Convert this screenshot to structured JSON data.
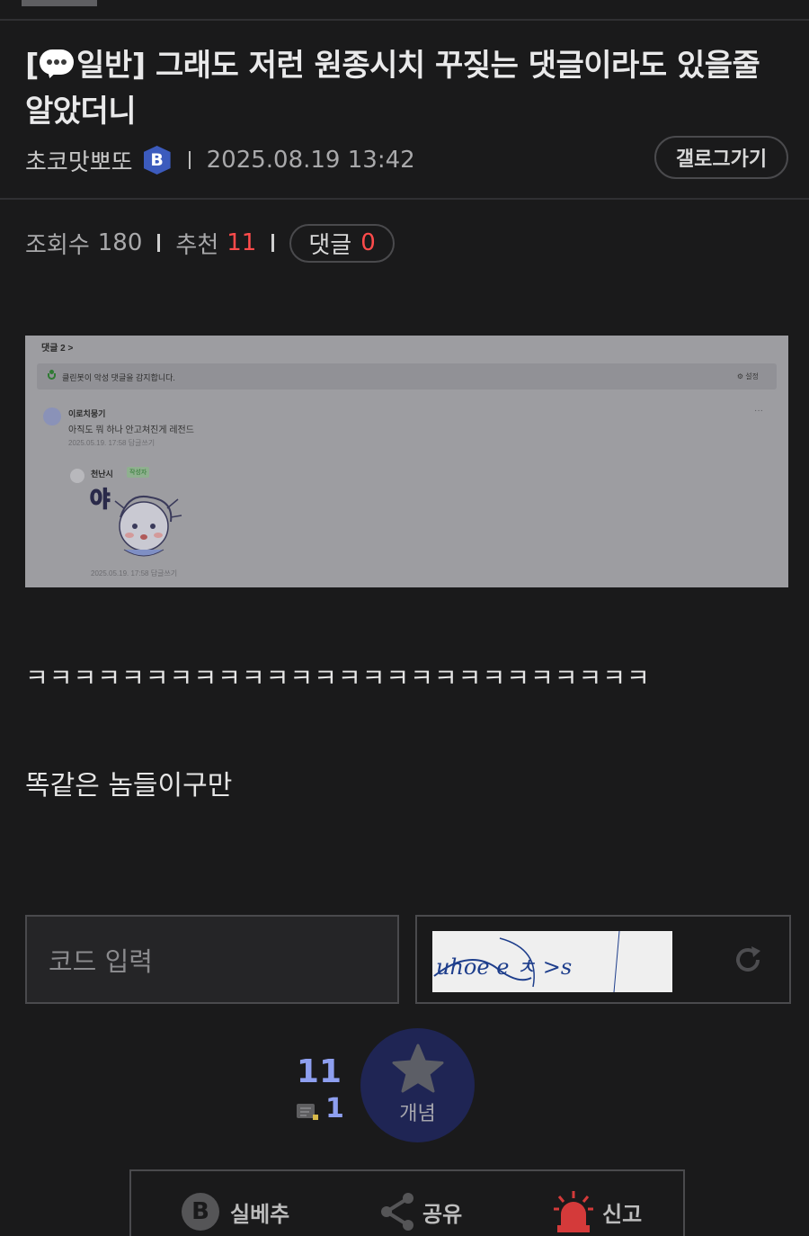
{
  "post": {
    "category": "일반",
    "title_rest": "그래도 저런 원종시치 꾸짖는 댓글이라도 있을줄 알았더니",
    "author": "초코맛뽀또",
    "author_badge": "B",
    "date": "2025.08.19 13:42",
    "gallery_button": "갤로그가기"
  },
  "stats": {
    "views_label": "조회수",
    "views": "180",
    "recommend_label": "추천",
    "recommend": "11",
    "comments_label": "댓글",
    "comments": "0"
  },
  "embedded_screenshot": {
    "header": "댓글 2 >",
    "cleanbot_notice": "클린봇이 악성 댓글을 감지합니다.",
    "settings": "설정",
    "more": "···",
    "comment1": {
      "author": "이로치뭉기",
      "text": "아직도 뭐 하나 안고쳐진게 레전드",
      "meta": "2025.05.19. 17:58   답글쓰기"
    },
    "comment2": {
      "author": "천난시",
      "tag": "작성자",
      "meta": "2025.05.19. 17:58   답글쓰기",
      "sticker_text": "야"
    }
  },
  "body": {
    "line1": "ㅋㅋㅋㅋㅋㅋㅋㅋㅋㅋㅋㅋㅋㅋㅋㅋㅋㅋㅋㅋㅋㅋㅋㅋㅋㅋ",
    "line2": "똑같은 놈들이구만"
  },
  "captcha": {
    "placeholder": "코드 입력",
    "image_text": "uhoe e ㅊ >s"
  },
  "vote": {
    "count": "11",
    "fix_count": "1",
    "button_label": "개념"
  },
  "actions": {
    "best": "실베추",
    "share": "공유",
    "report": "신고"
  },
  "colors": {
    "background": "#1a1a1b",
    "accent_red": "#ff4b4b",
    "vote_blue": "#8e9ff0",
    "vote_button": "#1f2554",
    "badge_blue": "#3c5bbd"
  }
}
